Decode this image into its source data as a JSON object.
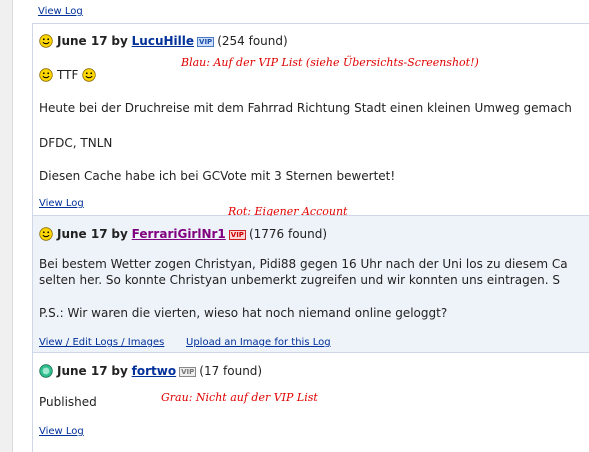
{
  "links": {
    "view_log": "View Log",
    "view_edit_logs_images": "View / Edit Logs / Images",
    "upload_image": "Upload an Image for this Log"
  },
  "vip_badge": "VIP",
  "logs": [
    {
      "date": "June 17",
      "by": "by",
      "user": "LucuHille",
      "found": "(254 found)",
      "line1": "TTF",
      "line2": "Heute bei der Druchreise mit dem Fahrrad Richtung Stadt einen kleinen Umweg gemach",
      "line3": "DFDC, TNLN",
      "line4": "Diesen Cache habe ich bei GCVote mit 3 Sternen bewertet!",
      "annotation": "Blau: Auf der VIP List (siehe Übersichts-Screenshot!)",
      "badge_color": "#cfe0ff"
    },
    {
      "date": "June 17",
      "by": "by",
      "user": "FerrariGirlNr1",
      "found": "(1776 found)",
      "line1": "Bei bestem Wetter zogen Christyan, Pidi88 gegen 16 Uhr nach der Uni los zu diesem Ca",
      "line2": "selten her. So konnte Christyan unbemerkt zugreifen und wir konnten uns eintragen. S",
      "line3": "P.S.: Wir waren die vierten, wieso hat noch niemand online geloggt?",
      "annotation": "Rot: Eigener Account",
      "badge_color": "#ffd7d7"
    },
    {
      "date": "June 17",
      "by": "by",
      "user": "fortwo",
      "found": "(17 found)",
      "line1": "Published",
      "annotation": "Grau: Nicht auf der VIP List",
      "badge_color": "#eeeeee"
    }
  ],
  "colors": {
    "link": "#00309a",
    "annotation": "#e00000",
    "alt_background": "#eef3f9"
  }
}
